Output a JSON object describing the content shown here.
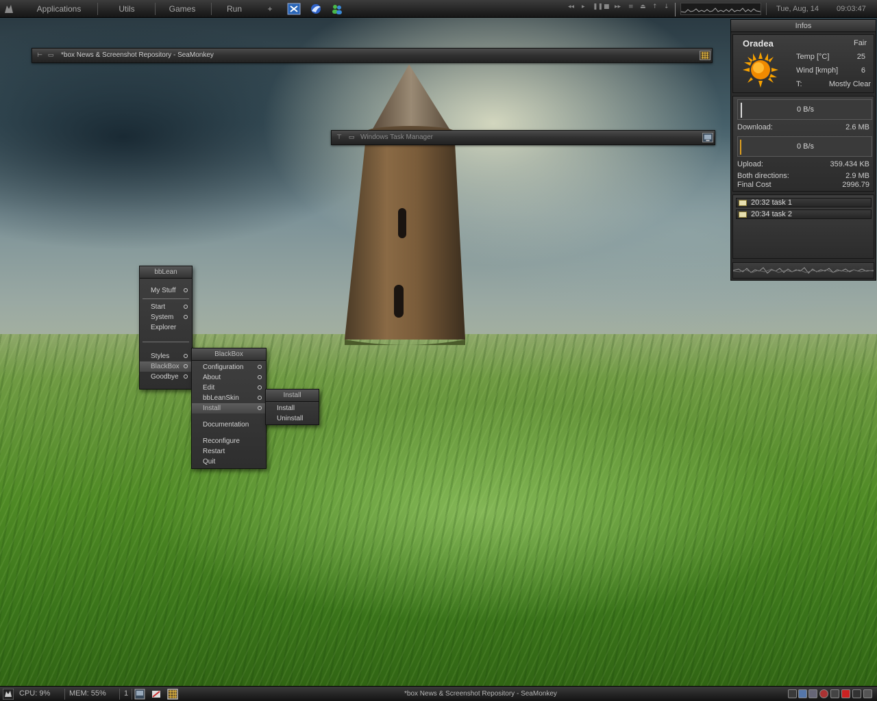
{
  "top_toolbar": {
    "menus": [
      "Applications",
      "Utils",
      "Games",
      "Run",
      "+"
    ],
    "media_controls": [
      "◂◂",
      "▸",
      "❚❚",
      "■",
      "▸▸",
      "≡",
      "⏏",
      "↑",
      "↓"
    ],
    "date": "Tue, Aug, 14",
    "time": "09:03:47",
    "app_icons": [
      "xml-editor-icon",
      "firefox-icon",
      "messenger-icon"
    ]
  },
  "windows": {
    "seamonkey_title": "*box News & Screenshot Repository - SeaMonkey",
    "task_manager_title": "Windows Task Manager"
  },
  "menus": {
    "bblean": {
      "title": "bbLean",
      "items": [
        "My Stuff",
        "Start",
        "System",
        "Explorer",
        "Styles",
        "BlackBox",
        "Goodbye"
      ]
    },
    "blackbox": {
      "title": "BlackBox",
      "items": [
        "Configuration",
        "About",
        "Edit",
        "bbLeanSkin",
        "Install",
        "Documentation",
        "Reconfigure",
        "Restart",
        "Quit"
      ]
    },
    "install": {
      "title": "Install",
      "items": [
        "Install",
        "Uninstall"
      ]
    }
  },
  "infos": {
    "title": "Infos",
    "weather": {
      "city": "Oradea",
      "condition": "Fair",
      "temp_label": "Temp [°C]",
      "temp_value": "25",
      "wind_label": "Wind [kmph]",
      "wind_value": "6",
      "t_label": "T:",
      "t_value": "Mostly Clear"
    },
    "network": {
      "download_rate": "0 B/s",
      "download_label": "Download:",
      "download_total": "2.6 MB",
      "upload_rate": "0 B/s",
      "upload_label": "Upload:",
      "upload_total": "359.434 KB",
      "both_label": "Both directions:",
      "both_total": "2.9 MB",
      "cost_label": "Final Cost",
      "cost_value": "2996.79"
    },
    "tasks": [
      {
        "label": "20:32 task 1"
      },
      {
        "label": "20:34 task 2"
      }
    ]
  },
  "taskbar": {
    "cpu": "CPU: 9%",
    "mem": "MEM: 55%",
    "workspace": "1",
    "active_window": "*box News & Screenshot Repository - SeaMonkey"
  },
  "colors": {
    "panel_dark": "#2c2c2c",
    "text_light": "#d8d8d8",
    "sun": "#f5a000"
  }
}
